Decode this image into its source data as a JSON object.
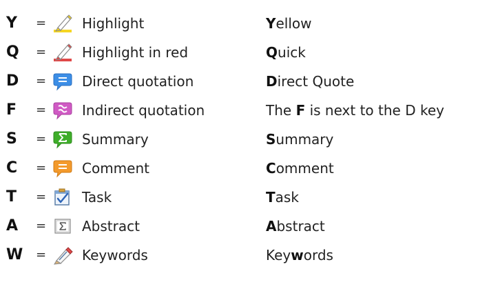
{
  "rows": [
    {
      "key": "Y",
      "equals": "=",
      "icon": "highlighter-yellow-icon",
      "label": "Highlight",
      "mnemonic": {
        "pre": "",
        "bold": "Y",
        "post": "ellow"
      }
    },
    {
      "key": "Q",
      "equals": "=",
      "icon": "highlighter-red-icon",
      "label": "Highlight in red",
      "mnemonic": {
        "pre": "",
        "bold": "Q",
        "post": "uick"
      }
    },
    {
      "key": "D",
      "equals": "=",
      "icon": "speech-bubble-blue-icon",
      "label": "Direct quotation",
      "mnemonic": {
        "pre": "",
        "bold": "D",
        "post": "irect Quote"
      }
    },
    {
      "key": "F",
      "equals": "=",
      "icon": "speech-bubble-pink-icon",
      "label": "Indirect quotation",
      "mnemonic": {
        "pre": "The ",
        "bold": "F",
        "post": " is next to the D key"
      }
    },
    {
      "key": "S",
      "equals": "=",
      "icon": "speech-bubble-green-sigma-icon",
      "label": "Summary",
      "mnemonic": {
        "pre": "",
        "bold": "S",
        "post": "ummary"
      }
    },
    {
      "key": "C",
      "equals": "=",
      "icon": "speech-bubble-orange-icon",
      "label": "Comment",
      "mnemonic": {
        "pre": "",
        "bold": "C",
        "post": "omment"
      }
    },
    {
      "key": "T",
      "equals": "=",
      "icon": "task-checkbox-icon",
      "label": "Task",
      "mnemonic": {
        "pre": "",
        "bold": "T",
        "post": "ask"
      }
    },
    {
      "key": "A",
      "equals": "=",
      "icon": "abstract-sigma-icon",
      "label": "Abstract",
      "mnemonic": {
        "pre": "",
        "bold": "A",
        "post": "bstract"
      }
    },
    {
      "key": "W",
      "equals": "=",
      "icon": "keywords-pencil-icon",
      "label": "Keywords",
      "mnemonic": {
        "pre": "Key",
        "bold": "w",
        "post": "ords"
      }
    }
  ],
  "colors": {
    "yellow": "#f2d21f",
    "red": "#e04848",
    "blue": "#3c8ee6",
    "pink": "#d05ac4",
    "green": "#3fae2a",
    "orange": "#f39a2c"
  }
}
